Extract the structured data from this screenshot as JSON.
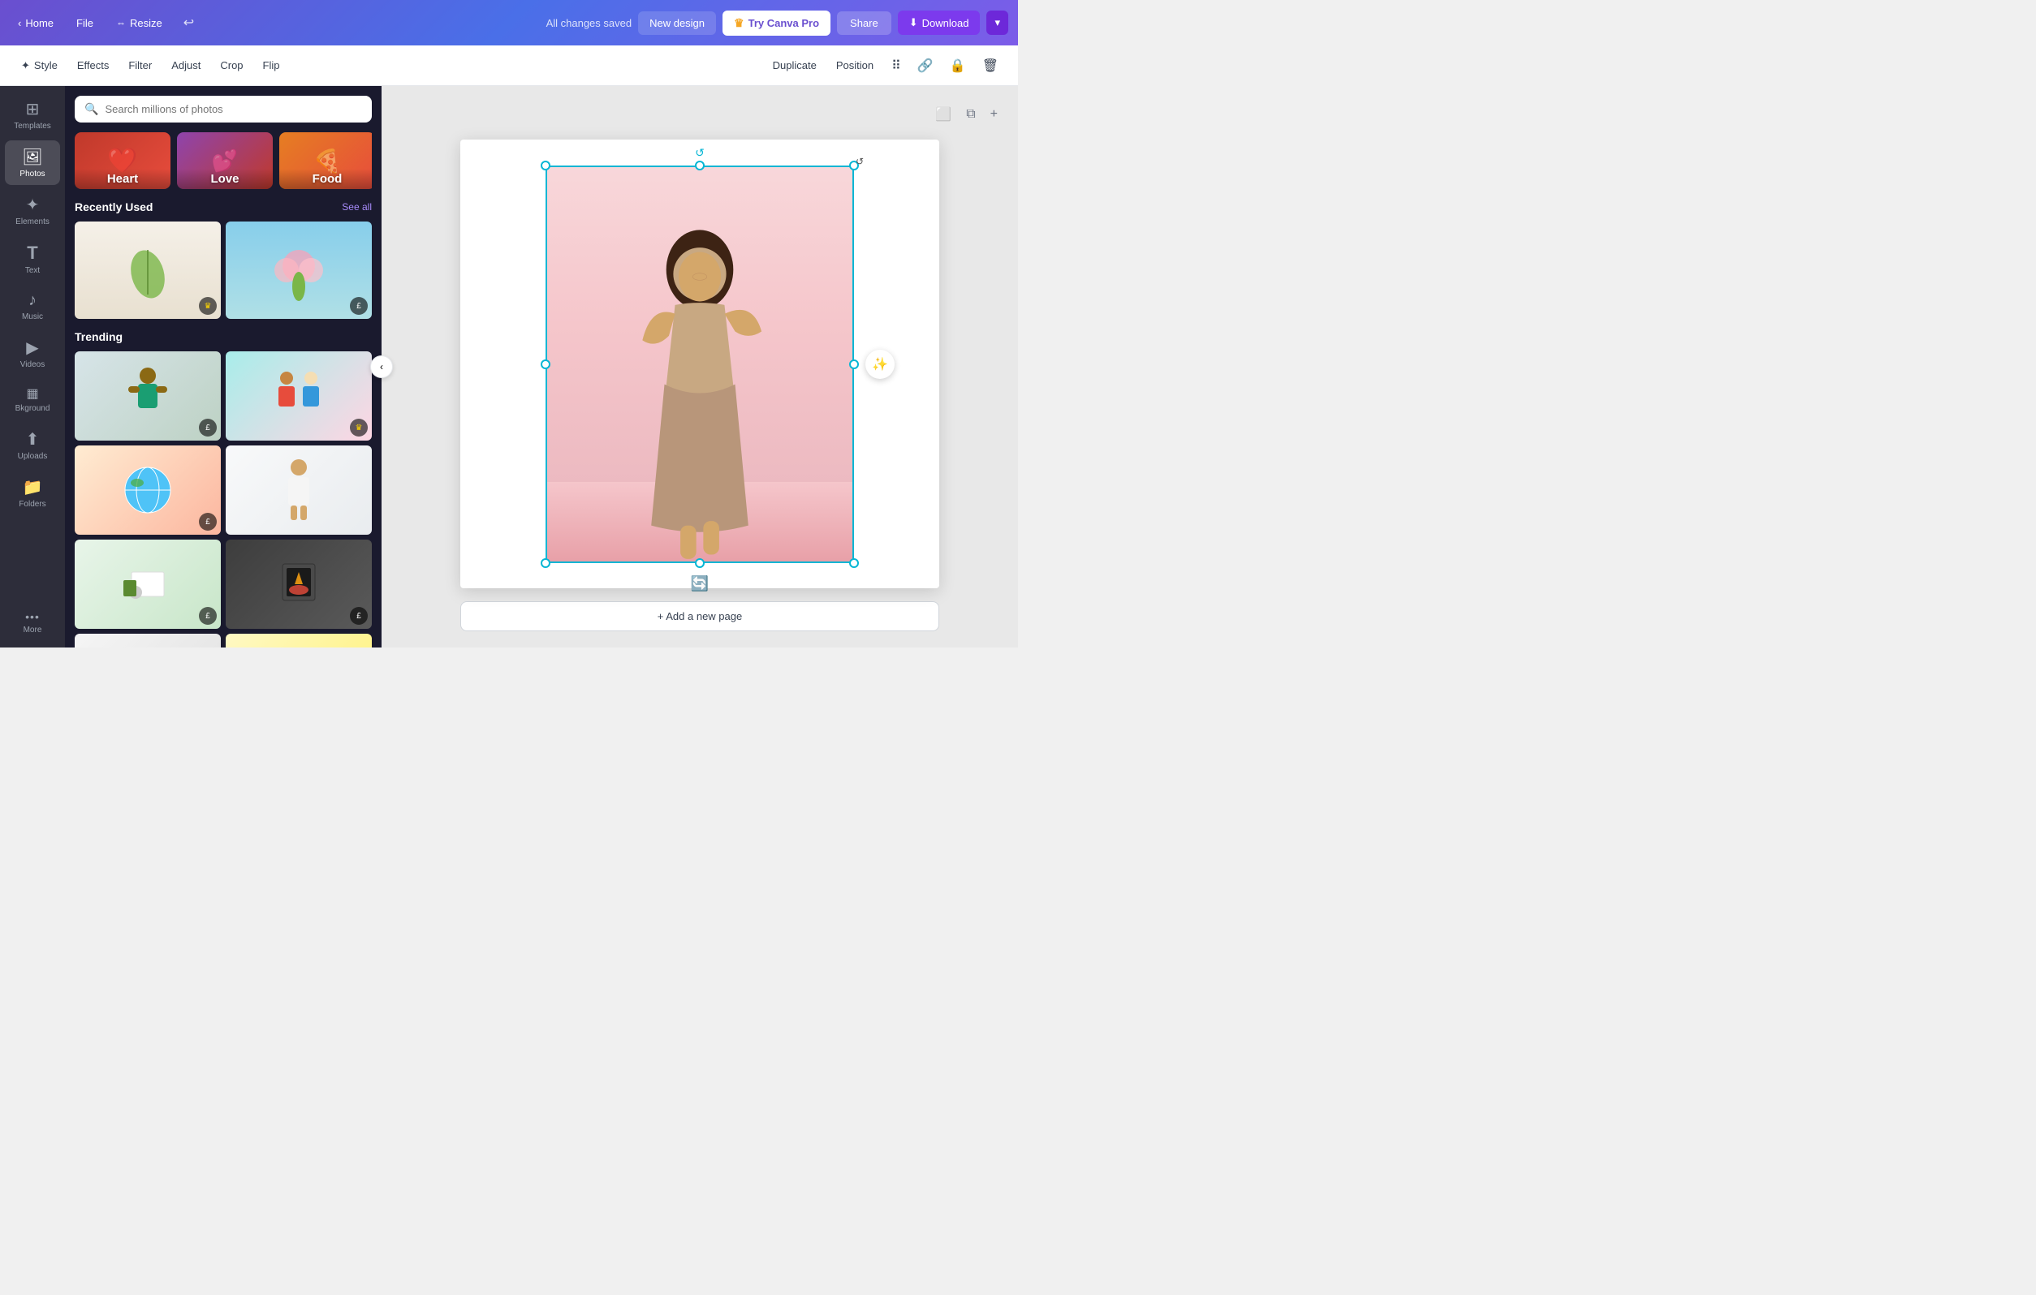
{
  "topNav": {
    "home_label": "Home",
    "file_label": "File",
    "resize_label": "Resize",
    "saved_label": "All changes saved",
    "new_design_label": "New design",
    "try_pro_label": "Try Canva Pro",
    "share_label": "Share",
    "download_label": "Download"
  },
  "toolbar": {
    "style_label": "Style",
    "effects_label": "Effects",
    "filter_label": "Filter",
    "adjust_label": "Adjust",
    "crop_label": "Crop",
    "flip_label": "Flip",
    "duplicate_label": "Duplicate",
    "position_label": "Position"
  },
  "sidebar": {
    "items": [
      {
        "id": "templates",
        "label": "Templates",
        "icon": "⊞"
      },
      {
        "id": "photos",
        "label": "Photos",
        "icon": "🖼"
      },
      {
        "id": "elements",
        "label": "Elements",
        "icon": "✦"
      },
      {
        "id": "text",
        "label": "Text",
        "icon": "T"
      },
      {
        "id": "music",
        "label": "Music",
        "icon": "♪"
      },
      {
        "id": "videos",
        "label": "Videos",
        "icon": "▶"
      },
      {
        "id": "background",
        "label": "Bkground",
        "icon": "⬜"
      },
      {
        "id": "uploads",
        "label": "Uploads",
        "icon": "↑"
      },
      {
        "id": "folders",
        "label": "Folders",
        "icon": "📁"
      },
      {
        "id": "more",
        "label": "More",
        "icon": "···"
      }
    ]
  },
  "photosPanel": {
    "search_placeholder": "Search millions of photos",
    "categories": [
      {
        "id": "heart",
        "label": "Heart",
        "deco": "❤️"
      },
      {
        "id": "love",
        "label": "Love",
        "deco": "💕"
      },
      {
        "id": "food",
        "label": "Food",
        "deco": "🍕"
      }
    ],
    "recently_used": {
      "title": "Recently Used",
      "see_all": "See all",
      "photos": [
        {
          "id": "ru1",
          "badge": "👑"
        },
        {
          "id": "ru2",
          "badge": "£"
        }
      ]
    },
    "trending": {
      "title": "Trending",
      "photos": [
        {
          "id": "t1",
          "badge": "£"
        },
        {
          "id": "t2",
          "badge": "👑"
        },
        {
          "id": "t3",
          "badge": "£"
        },
        {
          "id": "t4",
          "badge": ""
        },
        {
          "id": "t5",
          "badge": "£"
        },
        {
          "id": "t6",
          "badge": "£"
        },
        {
          "id": "t7",
          "badge": ""
        },
        {
          "id": "t8",
          "badge": ""
        }
      ]
    }
  },
  "canvas": {
    "add_page_label": "+ Add a new page"
  }
}
